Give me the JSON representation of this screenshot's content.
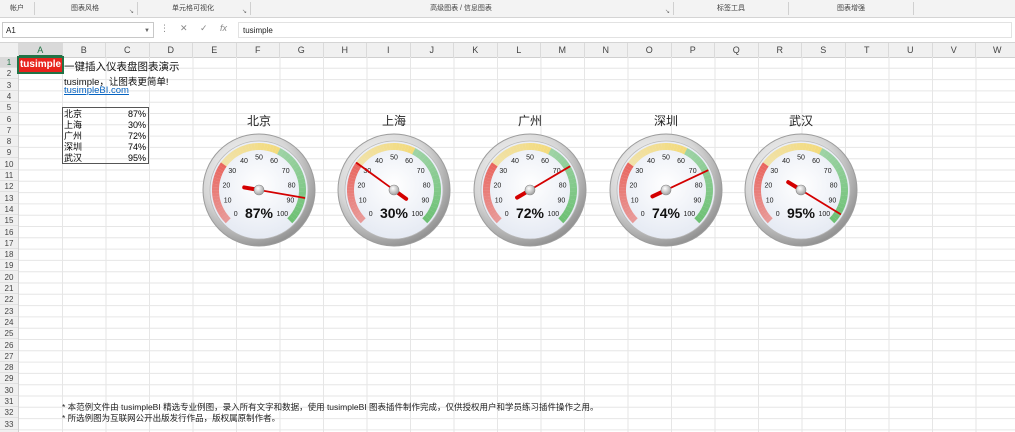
{
  "ribbon": {
    "groups": [
      "帐户",
      "图表风格",
      "单元格可视化",
      "高级图表 / 信息图表",
      "标签工具",
      "图表增强"
    ]
  },
  "formula_bar": {
    "name_box": "A1",
    "content": "tusimple"
  },
  "columns": [
    "A",
    "B",
    "C",
    "D",
    "E",
    "F",
    "G",
    "H",
    "I",
    "J",
    "K",
    "L",
    "M",
    "N",
    "O",
    "P",
    "Q",
    "R",
    "S",
    "T",
    "U",
    "V",
    "W"
  ],
  "rows": [
    "1",
    "2",
    "3",
    "4",
    "5",
    "6",
    "7",
    "8",
    "9",
    "10",
    "11",
    "12",
    "13",
    "14",
    "15",
    "16",
    "17",
    "18",
    "19",
    "20",
    "21",
    "22",
    "23",
    "24",
    "25",
    "26",
    "27",
    "28",
    "29",
    "30",
    "31",
    "32",
    "33"
  ],
  "sheet": {
    "a1": "tusimple",
    "title": "一键插入仪表盘图表演示",
    "tagline": "tusimple，让图表更简单!",
    "link": "tusimpleBI.com"
  },
  "table": [
    {
      "city": "北京",
      "value": "87%"
    },
    {
      "city": "上海",
      "value": "30%"
    },
    {
      "city": "广州",
      "value": "72%"
    },
    {
      "city": "深圳",
      "value": "74%"
    },
    {
      "city": "武汉",
      "value": "95%"
    }
  ],
  "chart_data": {
    "type": "gauge",
    "scale_min": 0,
    "scale_max": 100,
    "tick_labels": [
      "0",
      "10",
      "20",
      "30",
      "40",
      "50",
      "60",
      "70",
      "80",
      "90",
      "100"
    ],
    "zones": [
      {
        "from": 0,
        "to": 30,
        "color": "#e8544b"
      },
      {
        "from": 30,
        "to": 60,
        "color": "#f4d76a"
      },
      {
        "from": 60,
        "to": 100,
        "color": "#5dbb63"
      }
    ],
    "needle_color": "#d40000",
    "series": [
      {
        "name": "北京",
        "value": 87,
        "label": "87%"
      },
      {
        "name": "上海",
        "value": 30,
        "label": "30%"
      },
      {
        "name": "广州",
        "value": 72,
        "label": "72%"
      },
      {
        "name": "深圳",
        "value": 74,
        "label": "74%"
      },
      {
        "name": "武汉",
        "value": 95,
        "label": "95%"
      }
    ]
  },
  "notes": [
    "* 本范例文件由 tusimpleBI 精选专业例图，录入所有文字和数据，使用 tusimpleBI 图表插件制作完成，仅供授权用户和学员练习插件操作之用。",
    "* 所选例图为互联网公开出版发行作品，版权属原制作者。"
  ]
}
